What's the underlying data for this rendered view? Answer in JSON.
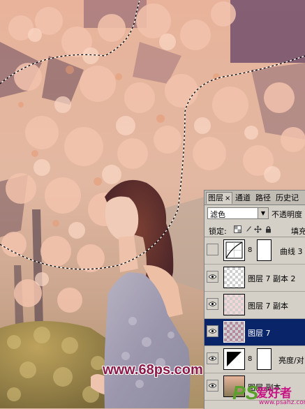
{
  "layers_panel": {
    "tabs": [
      {
        "label": "图层",
        "close": "×"
      },
      {
        "label": "通道"
      },
      {
        "label": "路径"
      },
      {
        "label": "历史记"
      }
    ],
    "blend_mode": "滤色",
    "opacity_label": "不透明度",
    "lock_label": "锁定:",
    "fill_label": "填充",
    "layers": [
      {
        "name": "曲线 3",
        "visible": false,
        "thumb": "curves-adjustment",
        "has_mask": true
      },
      {
        "name": "图层 7 副本 2",
        "visible": true,
        "thumb": "transparent",
        "has_mask": false
      },
      {
        "name": "图层 7 副本",
        "visible": true,
        "thumb": "transparent",
        "has_mask": false
      },
      {
        "name": "图层 7",
        "visible": true,
        "thumb": "transparent",
        "has_mask": false,
        "selected": true
      },
      {
        "name": "亮度/对",
        "visible": true,
        "thumb": "brightness-adjustment",
        "has_mask": true
      },
      {
        "name": "图层 副本",
        "visible": true,
        "thumb": "photo",
        "has_mask": false
      }
    ]
  },
  "watermarks": {
    "url": "www.68ps.com",
    "logo_ps": "PS",
    "logo_text": "爱好者",
    "logo_url": "www.psahz.com"
  },
  "colors": {
    "panel_bg": "#d4d0c8",
    "selected_row": "#0a246a",
    "watermark": "#8b1a4a"
  }
}
